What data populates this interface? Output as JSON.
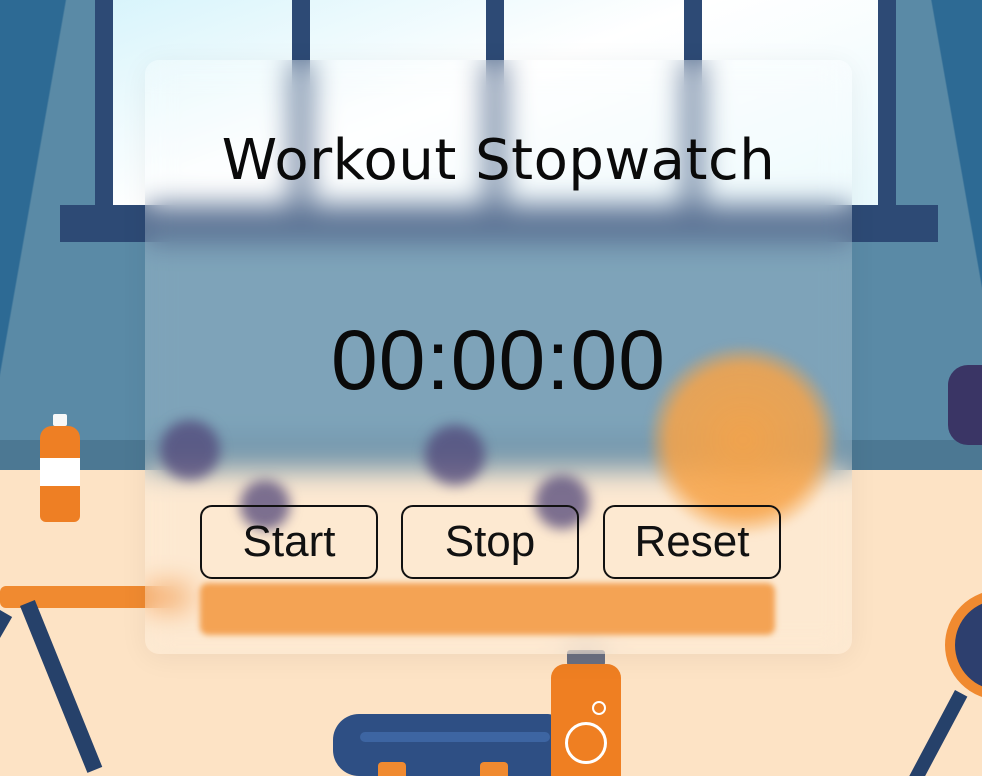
{
  "stopwatch": {
    "title": "Workout Stopwatch",
    "time": "00:00:00",
    "buttons": {
      "start": "Start",
      "stop": "Stop",
      "reset": "Reset"
    }
  },
  "colors": {
    "wall": "#5a8aa6",
    "window_frame": "#2d4a75",
    "floor": "#fde3c5",
    "accent_orange": "#ef7f22",
    "text": "#0a0a0a"
  }
}
